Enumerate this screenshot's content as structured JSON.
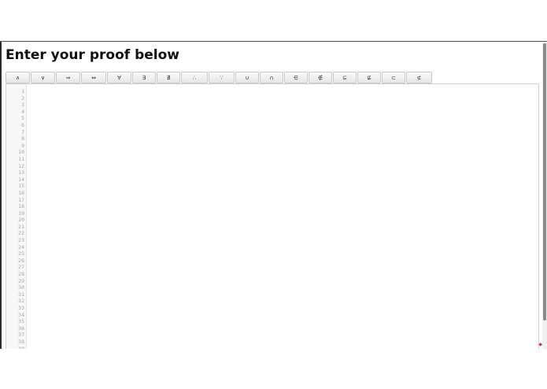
{
  "page": {
    "title": "Enter your proof below"
  },
  "toolbar": {
    "buttons": [
      {
        "label": "∧",
        "name": "and"
      },
      {
        "label": "∨",
        "name": "or"
      },
      {
        "label": "⇒",
        "name": "implies"
      },
      {
        "label": "⇔",
        "name": "iff"
      },
      {
        "label": "∀",
        "name": "for-all"
      },
      {
        "label": "∃",
        "name": "exists"
      },
      {
        "label": "∄",
        "name": "not-exists"
      },
      {
        "label": "∴",
        "name": "therefore"
      },
      {
        "label": "∵",
        "name": "because"
      },
      {
        "label": "∪",
        "name": "union"
      },
      {
        "label": "∩",
        "name": "intersection"
      },
      {
        "label": "∈",
        "name": "element-of"
      },
      {
        "label": "∉",
        "name": "not-element-of"
      },
      {
        "label": "⊆",
        "name": "subset-eq"
      },
      {
        "label": "⊈",
        "name": "not-subset-eq"
      },
      {
        "label": "⊂",
        "name": "subset"
      },
      {
        "label": "⊄",
        "name": "not-subset"
      }
    ]
  },
  "editor": {
    "line_numbers": [
      "1",
      "2",
      "3",
      "4",
      "5",
      "6",
      "7",
      "8",
      "9",
      "10",
      "11",
      "12",
      "13",
      "14",
      "15",
      "16",
      "17",
      "18",
      "19",
      "20",
      "21",
      "22",
      "23",
      "24",
      "25",
      "26",
      "27",
      "28",
      "29",
      "30",
      "31",
      "32",
      "33",
      "34",
      "35",
      "36",
      "37",
      "38",
      "39"
    ],
    "content": ""
  },
  "colors": {
    "border": "#555555",
    "accent_mark": "#c03060"
  }
}
